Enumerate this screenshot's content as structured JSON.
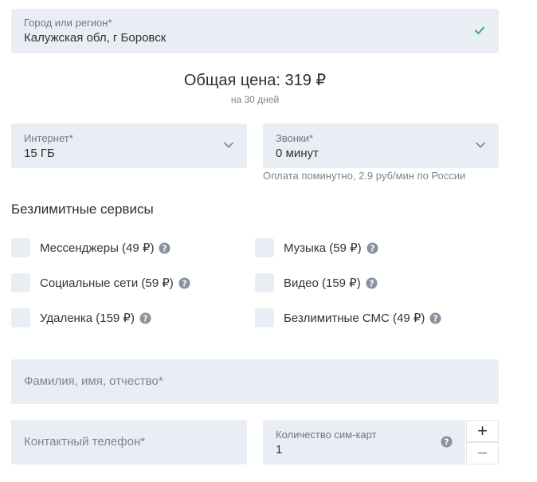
{
  "region": {
    "label": "Город или регион*",
    "value": "Калужская обл, г Боровск"
  },
  "price": {
    "total": "Общая цена: 319 ₽",
    "period": "на 30 дней"
  },
  "internet": {
    "label": "Интернет*",
    "value": "15 ГБ"
  },
  "calls": {
    "label": "Звонки*",
    "value": "0 минут",
    "note": "Оплата поминутно, 2.9 руб/мин по России"
  },
  "services": {
    "title": "Безлимитные сервисы",
    "items": [
      {
        "label": "Мессенджеры (49 ₽)"
      },
      {
        "label": "Музыка (59 ₽)"
      },
      {
        "label": "Социальные сети (59 ₽)"
      },
      {
        "label": "Видео (159 ₽)"
      },
      {
        "label": "Удаленка (159 ₽)"
      },
      {
        "label": "Безлимитные СМС (49 ₽)"
      }
    ]
  },
  "form": {
    "fullname_placeholder": "Фамилия, имя, отчество*",
    "phone_placeholder": "Контактный телефон*",
    "sim_label": "Количество сим-карт",
    "sim_value": "1",
    "plus": "+",
    "minus": "−"
  },
  "colors": {
    "field_bg": "#e9eef4",
    "check_green": "#3fae5a"
  }
}
